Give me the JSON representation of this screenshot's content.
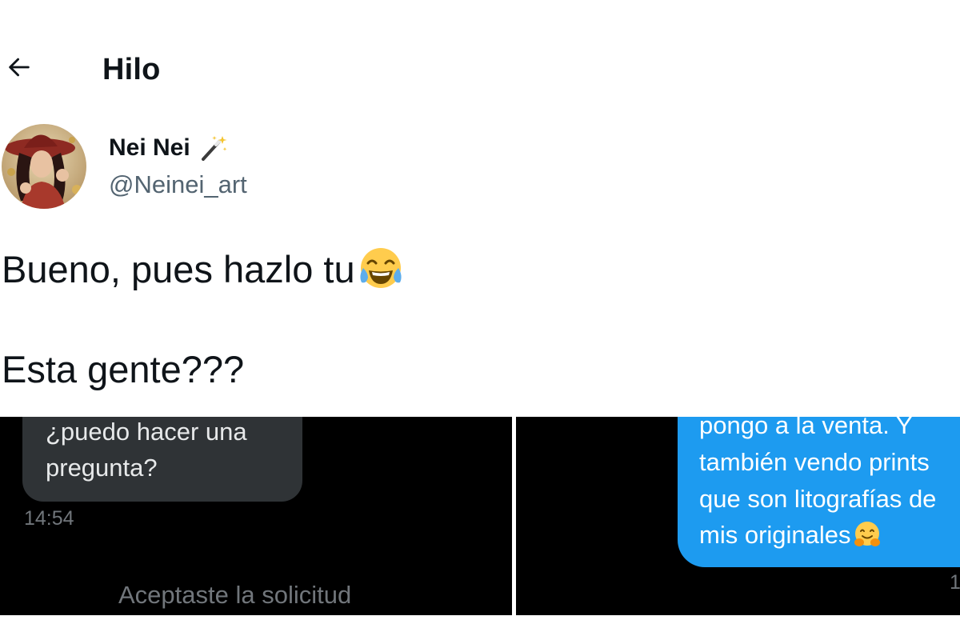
{
  "header": {
    "title": "Hilo"
  },
  "tweet": {
    "author_name": "Nei Nei",
    "author_handle": "@Neinei_art",
    "line1": "Bueno, pues hazlo tu",
    "line2": "Esta gente???"
  },
  "media_left": {
    "bubble_line1": "¿puedo hacer una",
    "bubble_line2": "pregunta?",
    "time": "14:54",
    "note": "Aceptaste la solicitud"
  },
  "media_right": {
    "line1": "pongo a la venta. Y",
    "line2": "también vendo prints",
    "line3": "que son litografías de",
    "line4": "mis originales",
    "time_fragment": "1"
  },
  "icons": {
    "back": "arrow-left-icon",
    "badge": "magic-wand-icon",
    "laugh": "face-with-tears-of-joy-emoji",
    "hug": "hugging-face-emoji"
  }
}
